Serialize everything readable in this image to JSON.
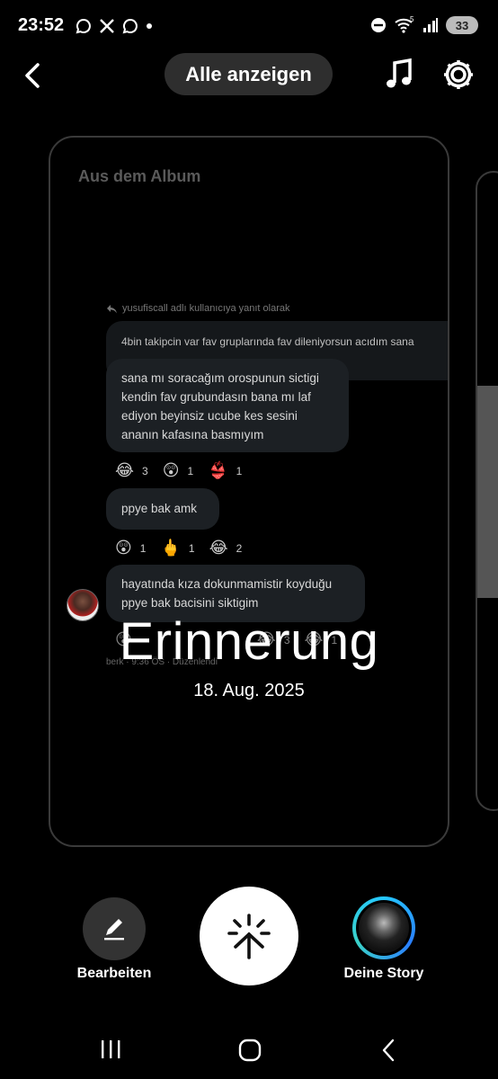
{
  "status_bar": {
    "time": "23:52",
    "network": "5",
    "battery": "33"
  },
  "header": {
    "show_all_label": "Alle anzeigen"
  },
  "card": {
    "title": "Aus dem Album",
    "chat": {
      "reply_hint": "yusufiscall adlı kullanıcıya yanıt olarak",
      "quoted_message": "4bin takipcin var fav gruplarında fav dileniyorsun acıdım sana",
      "messages": [
        {
          "lines": [
            "sana mı soracağım orospunun sictigi",
            "kendin fav grubundasın bana mı laf",
            "ediyon beyinsiz ucube kes sesini",
            "ananın kafasına basmıyım"
          ]
        },
        {
          "lines": [
            "ppye bak amk"
          ]
        },
        {
          "lines": [
            "hayatında kıza dokunmamistir koyduğu",
            "ppye bak bacisini siktigim"
          ]
        }
      ],
      "reactions_1": [
        {
          "emoji": "😂",
          "count": "3"
        },
        {
          "emoji": "😲",
          "count": "1"
        },
        {
          "emoji": "👙",
          "count": "1"
        }
      ],
      "reactions_2": [
        {
          "emoji": "😲",
          "count": "1"
        },
        {
          "emoji": "🖕",
          "count": "1"
        },
        {
          "emoji": "😂",
          "count": "2"
        }
      ],
      "reactions_3": [
        {
          "emoji": "😲",
          "count": ""
        },
        {
          "emoji": "😂",
          "count": "3"
        },
        {
          "emoji": "😂",
          "count": "1"
        }
      ],
      "meta": "berk · 9:36 ÖS · Düzenlendi"
    },
    "memory_title": "Erinnerung",
    "memory_date": "18. Aug. 2025"
  },
  "actions": {
    "edit_label": "Bearbeiten",
    "story_label": "Deine Story"
  },
  "colors": {
    "background": "#000000",
    "pill": "#2e2e2e",
    "bubble": "#1c2024",
    "story_ring": "#25c8ff"
  },
  "icons": [
    "back-arrow-icon",
    "music-note-icon",
    "settings-gear-icon",
    "pencil-icon",
    "share-burst-icon",
    "recents-icon",
    "home-icon",
    "nav-back-icon"
  ]
}
